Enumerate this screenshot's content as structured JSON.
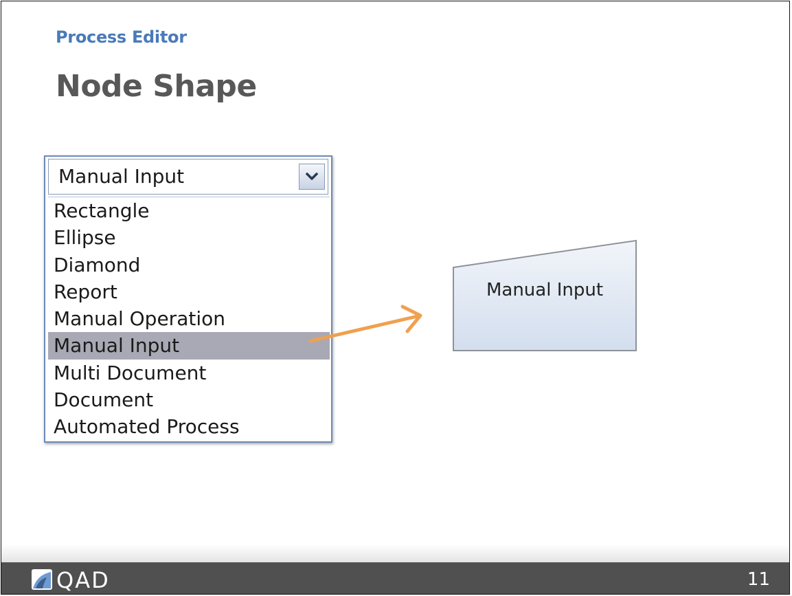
{
  "slide": {
    "section_title": "Process Editor",
    "title": "Node Shape",
    "page_number": "11"
  },
  "dropdown": {
    "selected_value": "Manual Input",
    "toggle_icon": "chevron-down-icon",
    "options": [
      "Rectangle",
      "Ellipse",
      "Diamond",
      "Report",
      "Manual Operation",
      "Manual Input",
      "Multi Document",
      "Document",
      "Automated Process"
    ],
    "highlighted_option": "Manual Input"
  },
  "preview": {
    "shape_label": "Manual Input",
    "shape_type": "manual-input-trapezoid"
  },
  "footer": {
    "logo_text": "QAD"
  },
  "colors": {
    "section_title": "#4a7ab8",
    "title": "#585858",
    "highlight": "#a8a9b4",
    "arrow": "#f0a050",
    "shape_fill": "#dde6f2",
    "footer": "#505050"
  }
}
